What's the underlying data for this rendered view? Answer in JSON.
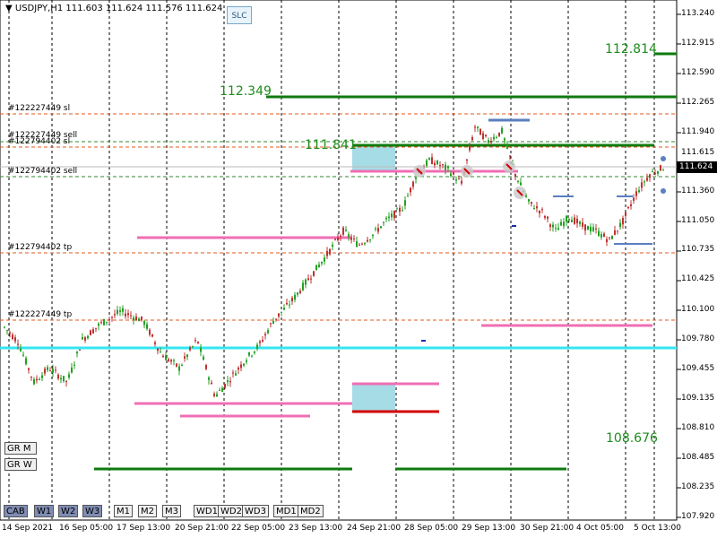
{
  "header": {
    "symbol_label": "USDJPY,H1",
    "ohlc": "111.603 111.624 111.576 111.624",
    "slc_button": "SLC"
  },
  "price_axis": {
    "ticks": [
      "113.240",
      "112.915",
      "112.590",
      "112.265",
      "111.940",
      "111.615",
      "111.360",
      "111.050",
      "110.735",
      "110.425",
      "110.100",
      "109.780",
      "109.455",
      "109.135",
      "108.810",
      "108.485",
      "108.235",
      "107.920"
    ],
    "current_price": "111.624"
  },
  "time_axis": {
    "ticks": [
      "14 Sep 2021",
      "16 Sep 05:00",
      "17 Sep 13:00",
      "20 Sep 21:00",
      "22 Sep 05:00",
      "23 Sep 13:00",
      "24 Sep 21:00",
      "28 Sep 05:00",
      "29 Sep 13:00",
      "30 Sep 21:00",
      "4 Oct 05:00",
      "5 Oct 13:00"
    ]
  },
  "order_labels": [
    "#122227449 sl",
    "#122227449 sell",
    "#122794402 sl",
    "#122794402 sell",
    "#122794402 tp",
    "#122227449 tp"
  ],
  "levels": {
    "l1": "112.814",
    "l2": "112.349",
    "l3": "111.841",
    "l4": "108.676"
  },
  "side_buttons": [
    "GR M",
    "GR W"
  ],
  "timeframe_buttons": [
    "CAB",
    "W1",
    "W2",
    "W3",
    "M1",
    "M2",
    "M3",
    "WD1",
    "WD2",
    "WD3",
    "MD1",
    "MD2"
  ],
  "colors": {
    "up_candle": "#22a022",
    "down_candle": "#c03030",
    "support": "#33e6f0",
    "level_green": "#0e7a0e",
    "zone_pink": "#f06eb4",
    "zone_red": "#d40000",
    "zone_fill": "#a6dce6",
    "orderline": "#e35a1e",
    "blue_marks": "#5a7fc0"
  }
}
